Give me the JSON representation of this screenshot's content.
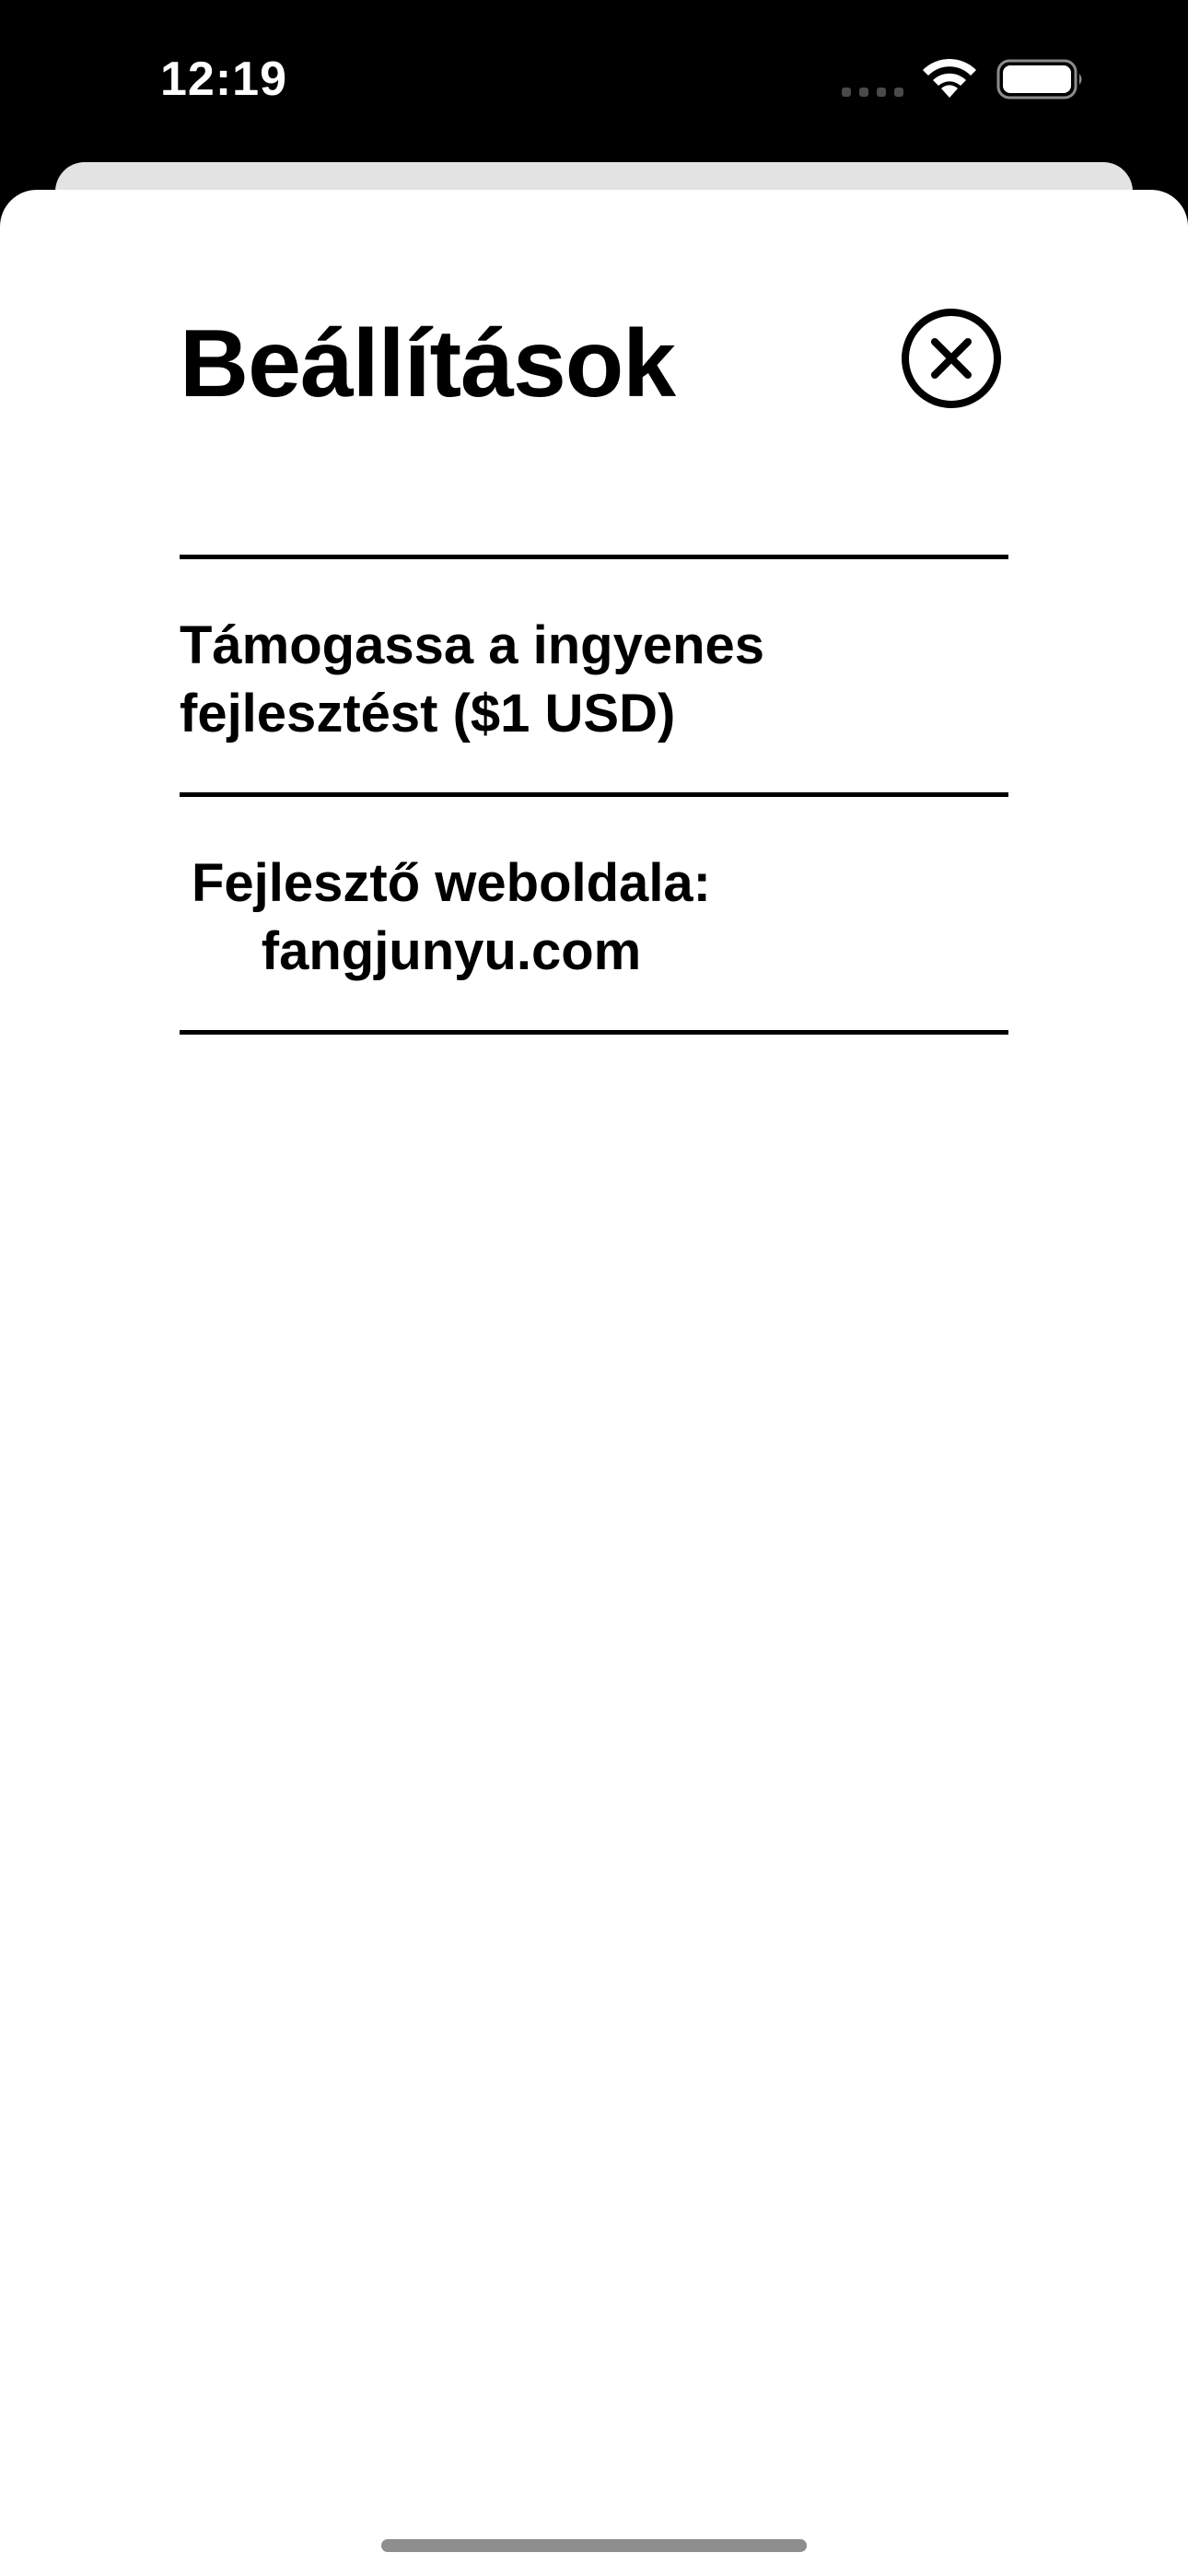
{
  "status_bar": {
    "time": "12:19",
    "icons": [
      "cellular-signal-icon",
      "wifi-icon",
      "battery-icon"
    ]
  },
  "sheet": {
    "title": "Beállítások",
    "close_icon": "close-circle-icon",
    "rows": [
      {
        "label": "Támogassa a ingyenes fejlesztést ($1 USD)"
      },
      {
        "label": "Fejlesztő weboldala: fangjunyu.com"
      }
    ]
  },
  "colors": {
    "background": "#000000",
    "sheet": "#ffffff",
    "text": "#000000",
    "back_card": "#e3e3e3",
    "home_indicator": "#8e8e8e"
  }
}
